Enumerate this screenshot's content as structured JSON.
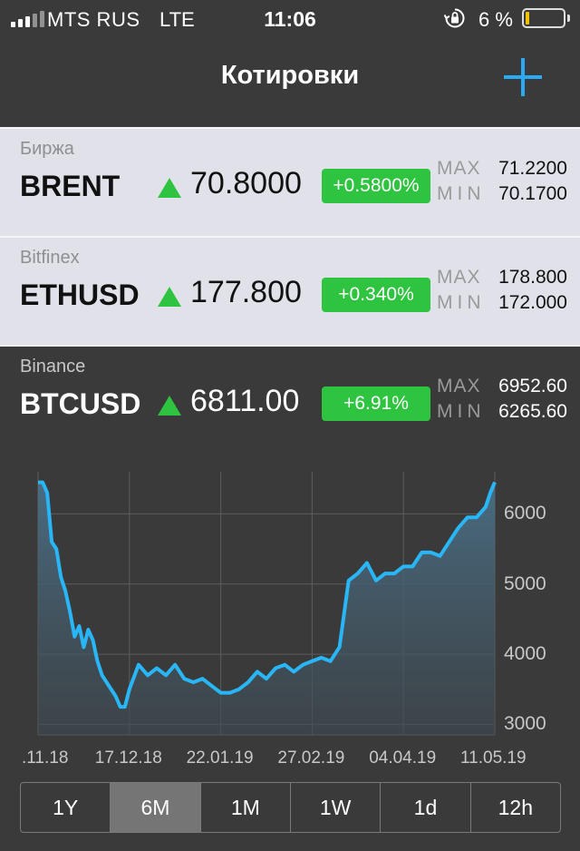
{
  "status_bar": {
    "carrier": "MTS RUS",
    "network": "LTE",
    "time": "11:06",
    "battery_text": "6 %",
    "battery_level": 0.06,
    "icons": [
      "signal-icon",
      "orientation-lock-icon",
      "battery-icon"
    ]
  },
  "nav": {
    "title": "Котировки",
    "add_icon": "plus-icon",
    "accent": "#2aa9f5"
  },
  "quotes": [
    {
      "exchange": "Биржа",
      "symbol": "BRENT",
      "direction": "up",
      "price": "70.8000",
      "change": "+0.5800%",
      "max_label": "MAX",
      "max": "71.2200",
      "min_label": "MIN",
      "min": "70.1700",
      "selected": false
    },
    {
      "exchange": "Bitfinex",
      "symbol": "ETHUSD",
      "direction": "up",
      "price": "177.800",
      "change": "+0.340%",
      "max_label": "MAX",
      "max": "178.800",
      "min_label": "MIN",
      "min": "172.000",
      "selected": false
    },
    {
      "exchange": "Binance",
      "symbol": "BTCUSD",
      "direction": "up",
      "price": "6811.00",
      "change": "+6.91%",
      "max_label": "MAX",
      "max": "6952.60",
      "min_label": "MIN",
      "min": "6265.60",
      "selected": true
    }
  ],
  "colors": {
    "up": "#2fc43f",
    "line": "#29b6f6",
    "background": "#3a3a3a",
    "row_light": "#e1e2e9"
  },
  "chart_data": {
    "type": "area",
    "x_tick_labels": [
      ".11.18",
      "17.12.18",
      "22.01.19",
      "27.02.19",
      "04.04.19",
      "11.05.19"
    ],
    "y_tick_labels": [
      "6000",
      "5000",
      "4000",
      "3000"
    ],
    "y_ticks": [
      6000,
      5000,
      4000,
      3000
    ],
    "ylim": [
      2850,
      6600
    ],
    "xlim": [
      0,
      100
    ],
    "grid": true,
    "x": [
      0,
      1,
      2,
      3,
      4,
      5,
      6,
      7,
      8,
      9,
      10,
      11,
      12,
      13,
      14,
      15,
      16,
      17,
      18,
      19,
      20,
      22,
      24,
      26,
      28,
      30,
      32,
      34,
      36,
      38,
      40,
      42,
      44,
      46,
      48,
      50,
      52,
      54,
      56,
      58,
      60,
      62,
      64,
      66,
      68,
      70,
      72,
      74,
      76,
      78,
      80,
      82,
      84,
      86,
      88,
      90,
      92,
      94,
      96,
      98,
      99,
      100
    ],
    "y": [
      6450,
      6450,
      6300,
      5600,
      5500,
      5100,
      4900,
      4600,
      4250,
      4400,
      4100,
      4350,
      4200,
      3900,
      3700,
      3600,
      3500,
      3400,
      3250,
      3250,
      3500,
      3850,
      3700,
      3800,
      3700,
      3850,
      3650,
      3600,
      3650,
      3550,
      3450,
      3450,
      3500,
      3600,
      3750,
      3650,
      3800,
      3850,
      3750,
      3850,
      3900,
      3950,
      3900,
      4100,
      5050,
      5150,
      5300,
      5050,
      5150,
      5150,
      5250,
      5250,
      5450,
      5450,
      5400,
      5600,
      5800,
      5950,
      5950,
      6100,
      6300,
      6450
    ]
  },
  "ranges": {
    "options": [
      "1Y",
      "6M",
      "1M",
      "1W",
      "1d",
      "12h"
    ],
    "selected": "6M"
  }
}
